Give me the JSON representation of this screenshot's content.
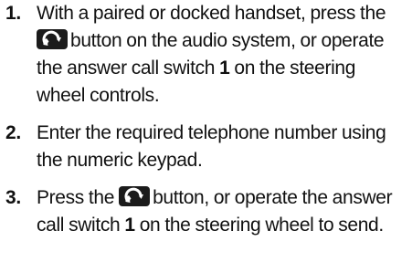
{
  "steps": [
    {
      "number": "1.",
      "text_a": "With a paired or docked handset, press the",
      "text_b": "button on the audio system, or operate the answer call switch",
      "switch_number": "1",
      "text_c": "on the steering wheel controls."
    },
    {
      "number": "2.",
      "text_a": "Enter the required telephone number using the numeric keypad."
    },
    {
      "number": "3.",
      "text_a": "Press the",
      "text_b": "button, or operate the answer call switch",
      "switch_number": "1",
      "text_c": "on the steering wheel to send."
    }
  ],
  "icons": {
    "call_button": "phone-answer-icon"
  },
  "colors": {
    "text": "#111111",
    "icon_background": "#1b1b1b",
    "icon_foreground": "#ffffff"
  }
}
